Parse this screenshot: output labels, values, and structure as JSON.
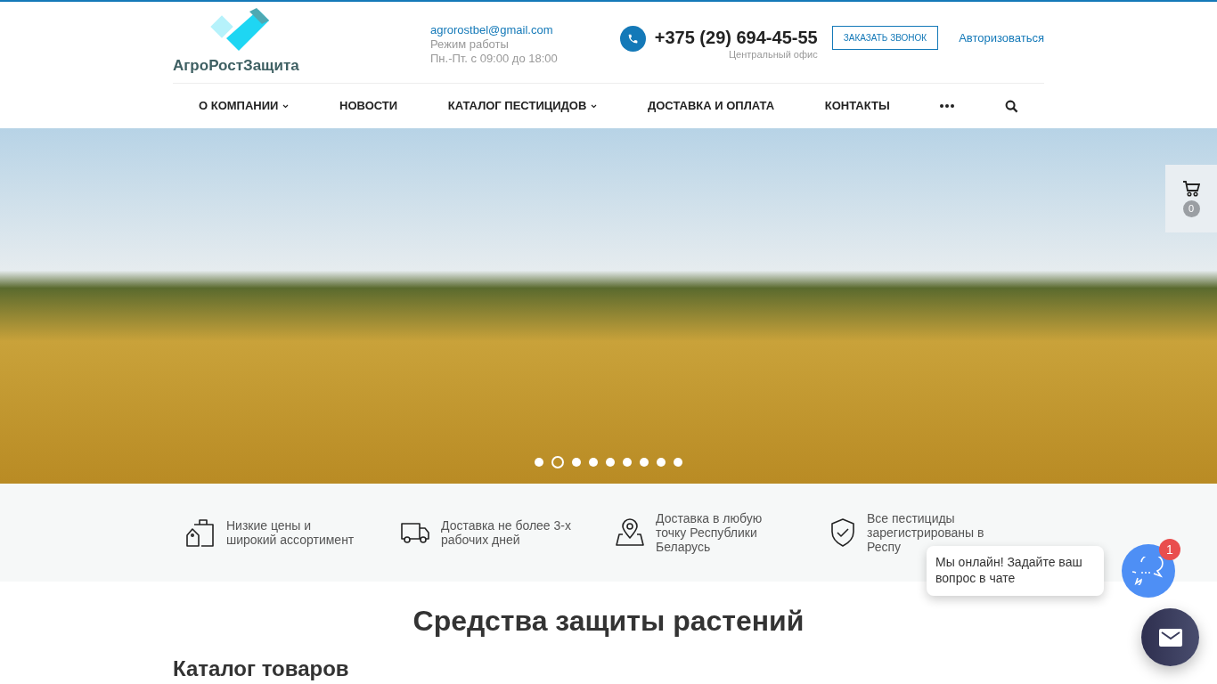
{
  "header": {
    "logo_text": "АгроРостЗащита",
    "email": "agrorostbel@gmail.com",
    "hours_label": "Режим работы",
    "hours": "Пн.-Пт. с 09:00 до 18:00",
    "phone": "+375 (29) 694-45-55",
    "phone_note": "Центральный офис",
    "callback_button": "ЗАКАЗАТЬ ЗВОНОК",
    "login_link": "Авторизоваться"
  },
  "nav": [
    {
      "label": "О КОМПАНИИ",
      "dropdown": true
    },
    {
      "label": "НОВОСТИ",
      "dropdown": false
    },
    {
      "label": "КАТАЛОГ ПЕСТИЦИДОВ",
      "dropdown": true
    },
    {
      "label": "ДОСТАВКА И ОПЛАТА",
      "dropdown": false
    },
    {
      "label": "КОНТАКТЫ",
      "dropdown": false
    }
  ],
  "slider_dots": [
    {
      "selected": false
    },
    {
      "selected": true
    },
    {
      "selected": false
    },
    {
      "selected": false
    },
    {
      "selected": false
    },
    {
      "selected": false
    },
    {
      "selected": false
    },
    {
      "selected": false
    },
    {
      "selected": false
    }
  ],
  "cart": {
    "count": "0"
  },
  "features": [
    {
      "kind": "price",
      "text": "Низкие цены и широкий ассортимент"
    },
    {
      "kind": "delivery",
      "text": "Доставка не более 3-х рабочих дней"
    },
    {
      "kind": "location",
      "text": "Доставка в любую точку Республики Беларусь"
    },
    {
      "kind": "certified",
      "text": "Все пестициды зарегистрированы в Респу"
    }
  ],
  "page_title": "Средства защиты растений",
  "section_title": "Каталог товаров",
  "chat": {
    "popup": "Мы онлайн! Задайте ваш вопрос в чате",
    "badge": "1"
  }
}
